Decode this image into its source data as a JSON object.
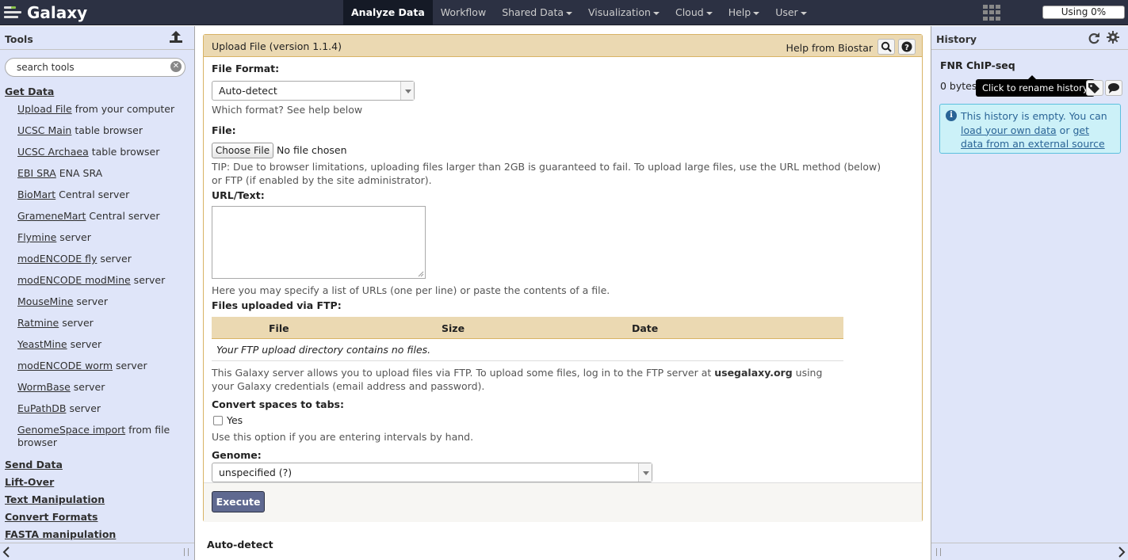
{
  "masthead": {
    "brand": "Galaxy",
    "tabs": [
      {
        "label": "Analyze Data",
        "active": true,
        "dropdown": false
      },
      {
        "label": "Workflow",
        "active": false,
        "dropdown": false
      },
      {
        "label": "Shared Data",
        "active": false,
        "dropdown": true
      },
      {
        "label": "Visualization",
        "active": false,
        "dropdown": true
      },
      {
        "label": "Cloud",
        "active": false,
        "dropdown": true
      },
      {
        "label": "Help",
        "active": false,
        "dropdown": true
      },
      {
        "label": "User",
        "active": false,
        "dropdown": true
      }
    ],
    "quota": "Using 0%"
  },
  "tools_panel": {
    "title": "Tools",
    "search_placeholder": "search tools",
    "sections_top": [
      "Get Data"
    ],
    "tools": [
      {
        "link": "Upload File",
        "rest": " from your computer"
      },
      {
        "link": "UCSC Main",
        "rest": " table browser"
      },
      {
        "link": "UCSC Archaea",
        "rest": " table browser"
      },
      {
        "link": "EBI SRA",
        "rest": " ENA SRA"
      },
      {
        "link": "BioMart",
        "rest": " Central server"
      },
      {
        "link": "GrameneMart",
        "rest": " Central server"
      },
      {
        "link": "Flymine",
        "rest": " server"
      },
      {
        "link": "modENCODE fly",
        "rest": " server"
      },
      {
        "link": "modENCODE modMine",
        "rest": " server"
      },
      {
        "link": "MouseMine",
        "rest": " server"
      },
      {
        "link": "Ratmine",
        "rest": " server"
      },
      {
        "link": "YeastMine",
        "rest": " server"
      },
      {
        "link": "modENCODE worm",
        "rest": " server"
      },
      {
        "link": "WormBase",
        "rest": " server"
      },
      {
        "link": "EuPathDB",
        "rest": " server"
      },
      {
        "link": "GenomeSpace import",
        "rest": " from file browser"
      }
    ],
    "sections": [
      "Send Data",
      "Lift-Over",
      "Text Manipulation",
      "Convert Formats",
      "FASTA manipulation"
    ]
  },
  "form": {
    "title": "Upload File (version 1.1.4)",
    "help_from": "Help from Biostar",
    "file_format_label": "File Format:",
    "file_format_value": "Auto-detect",
    "file_format_help": "Which format? See help below",
    "file_label": "File:",
    "choose_file": "Choose File",
    "no_file": "No file chosen",
    "file_tip": "TIP: Due to browser limitations, uploading files larger than 2GB is guaranteed to fail. To upload large files, use the URL method (below) or FTP (if enabled by the site administrator).",
    "url_label": "URL/Text:",
    "url_help": "Here you may specify a list of URLs (one per line) or paste the contents of a file.",
    "ftp_label": "Files uploaded via FTP:",
    "ftp_columns": [
      "File",
      "Size",
      "Date"
    ],
    "ftp_empty": "Your FTP upload directory contains no files.",
    "ftp_help_pre": "This Galaxy server allows you to upload files via FTP. To upload some files, log in to the FTP server at ",
    "ftp_host": "usegalaxy.org",
    "ftp_help_post": " using your Galaxy credentials (email address and password).",
    "convert_label": "Convert spaces to tabs:",
    "convert_option": "Yes",
    "convert_help": "Use this option if you are entering intervals by hand.",
    "genome_label": "Genome:",
    "genome_value": "unspecified (?)",
    "execute": "Execute",
    "below_label": "Auto-detect"
  },
  "history": {
    "title": "History",
    "name": "FNR ChIP-seq",
    "size": "0 bytes",
    "tooltip": "Click to rename history",
    "empty_pre": "This history is empty. You can ",
    "empty_link1": "load your own data",
    "empty_mid": " or ",
    "empty_link2": "get data from an external source"
  }
}
